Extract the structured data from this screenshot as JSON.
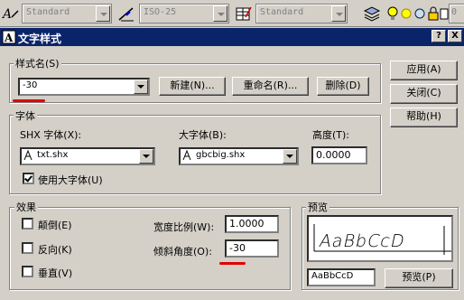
{
  "toolbar": {
    "text_style_combo": "Standard",
    "dim_style_combo": "ISO-25",
    "table_style_combo": "Standard",
    "fifth_combo": "0"
  },
  "dialog": {
    "title": "文字样式",
    "help_btn": "?",
    "close_btn": "X"
  },
  "style_name": {
    "group_label": "样式名(S)",
    "value": "-30",
    "new_button": "新建(N)...",
    "rename_button": "重命名(R)...",
    "delete_button": "删除(D)"
  },
  "side_buttons": {
    "apply": "应用(A)",
    "close": "关闭(C)",
    "help": "帮助(H)"
  },
  "font": {
    "group_label": "字体",
    "shx_label": "SHX 字体(X):",
    "shx_value": "txt.shx",
    "big_label": "大字体(B):",
    "big_value": "gbcbig.shx",
    "height_label": "高度(T):",
    "height_value": "0.0000",
    "use_bigfont_label": "使用大字体(U)",
    "use_bigfont_checked": true
  },
  "effects": {
    "group_label": "效果",
    "upside_down": "颠倒(E)",
    "backwards": "反向(K)",
    "vertical": "垂直(V)",
    "width_factor_label": "宽度比例(W):",
    "width_factor_value": "1.0000",
    "oblique_label": "倾斜角度(O):",
    "oblique_value": "-30"
  },
  "preview": {
    "group_label": "预览",
    "sample_text": "AaBbCcD",
    "preview_input": "AaBbCcD",
    "preview_button": "预览(P)"
  },
  "colors": {
    "title_bar": "#0a246a",
    "annotation": "#e00000",
    "dialog_face": "#d4d0c8"
  }
}
